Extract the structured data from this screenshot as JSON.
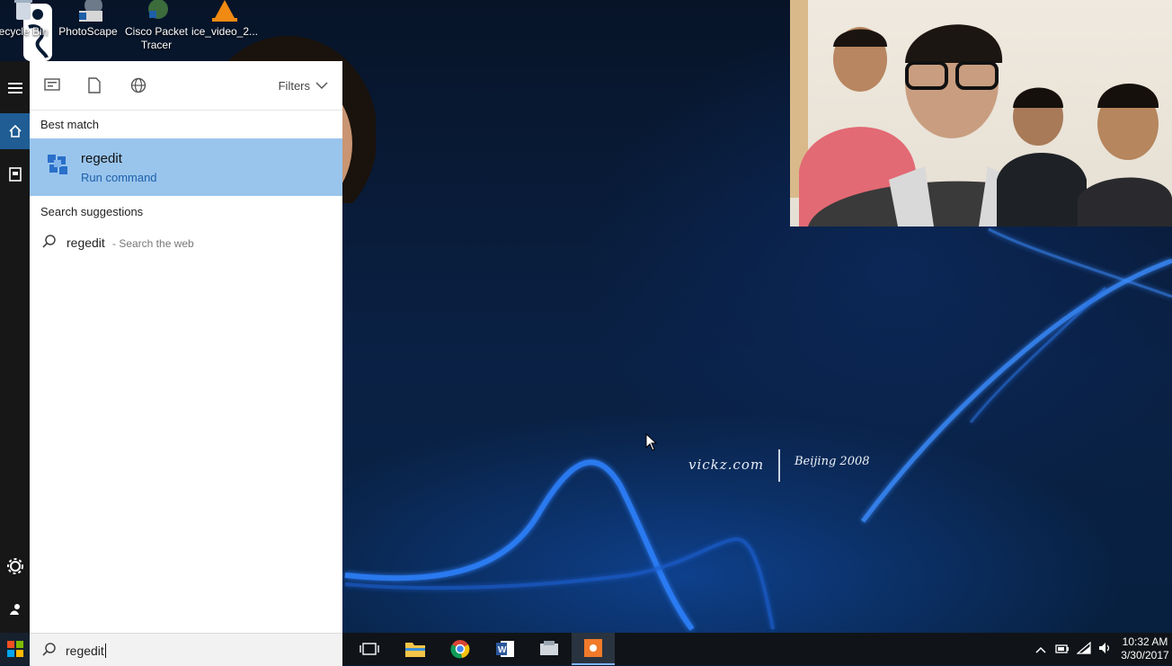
{
  "desktop": {
    "icons": [
      {
        "label": "ecycle Bin",
        "icon": "recycle-bin-icon"
      },
      {
        "label": "PhotoScape",
        "icon": "photoscape-icon"
      },
      {
        "label": "Cisco Packet Tracer",
        "icon": "cisco-packet-tracer-icon"
      },
      {
        "label": "ice_video_2...",
        "icon": "vlc-cone-icon"
      }
    ],
    "watermark": "vickz.com",
    "beijing_text": "Beijing 2008"
  },
  "start_menu": {
    "rail": [
      "hamburger-icon",
      "home-icon",
      "notebook-icon",
      "settings-icon",
      "feedback-icon"
    ],
    "toolbar": {
      "icons": [
        "apps-filter-icon",
        "documents-filter-icon",
        "web-filter-icon"
      ],
      "filters_label": "Filters"
    },
    "best_match": {
      "heading": "Best match",
      "name": "regedit",
      "subtitle": "Run command"
    },
    "suggestions": {
      "heading": "Search suggestions",
      "items": [
        {
          "query": "regedit",
          "hint": "- Search the web"
        }
      ]
    },
    "search_box": {
      "value": "regedit"
    }
  },
  "taskbar": {
    "apps": [
      "task-view-icon",
      "file-explorer-icon",
      "chrome-icon",
      "word-icon",
      "app-icon",
      "recorder-icon"
    ],
    "active_app": "recorder-icon",
    "clock": {
      "time": "10:32 AM",
      "date": "3/30/2017"
    },
    "tray": [
      "chevron-up-icon",
      "battery-icon",
      "wifi-icon",
      "volume-icon"
    ]
  },
  "colors": {
    "accent": "#1f5d94",
    "best_match_bg": "#99c5ed",
    "run_command": "#1d5fa8",
    "taskbar": "#101418"
  }
}
